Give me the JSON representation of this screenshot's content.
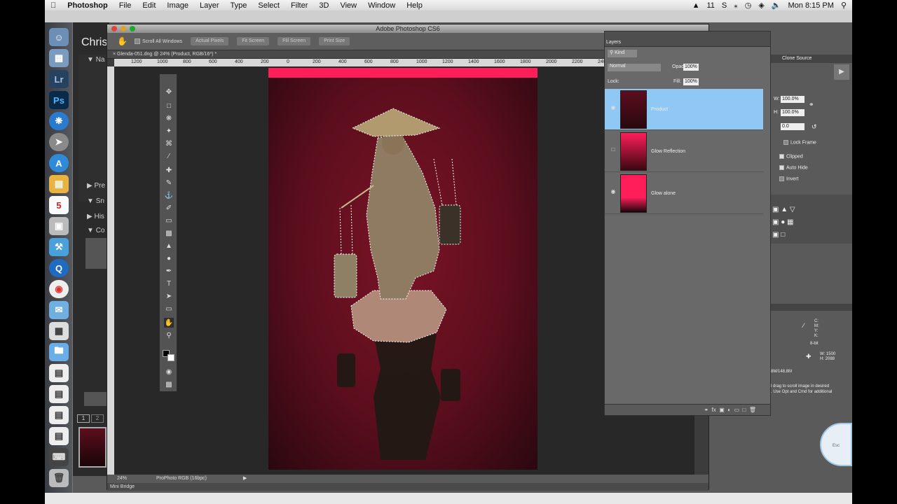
{
  "menubar": {
    "items": [
      "Photoshop",
      "File",
      "Edit",
      "Image",
      "Layer",
      "Type",
      "Select",
      "Filter",
      "3D",
      "View",
      "Window",
      "Help"
    ],
    "clock": "Mon 8:15 PM",
    "status_num": "11",
    "status_s": "S"
  },
  "lightroom": {
    "title": "Chris",
    "sections": [
      "Na",
      "Pre",
      "Sn",
      "His",
      "Co"
    ],
    "page_nums": [
      "1",
      "2"
    ]
  },
  "photoshop": {
    "window_title": "Adobe Photoshop CS6",
    "options": {
      "scroll_all_label": "Scroll All Windows",
      "buttons": [
        "Actual Pixels",
        "Fit Screen",
        "Fill Screen",
        "Print Size"
      ]
    },
    "doc_tab": "Glenda-051.dng @ 24% (Product, RGB/16*) *",
    "ruler": [
      "1200",
      "1000",
      "800",
      "600",
      "400",
      "200",
      "0",
      "200",
      "400",
      "600",
      "800",
      "1000",
      "1200",
      "1400",
      "1600",
      "1800",
      "2000",
      "2200",
      "2400",
      "2600",
      "2800"
    ],
    "status": {
      "zoom": "24%",
      "profile": "ProPhoto RGB (16bpc)"
    },
    "mini_bridge": "Mini Bridge"
  },
  "layers_panel": {
    "tab": "Layers",
    "kind": "Kind",
    "blend": "Normal",
    "opacity_label": "Opacity:",
    "opacity": "100%",
    "lock_label": "Lock:",
    "fill_label": "Fill:",
    "fill": "100%",
    "layers": [
      {
        "name": "Product",
        "visible": true,
        "selected": true
      },
      {
        "name": "Glow Reflection",
        "visible": false,
        "selected": false
      },
      {
        "name": "Glow alone",
        "visible": true,
        "selected": false
      }
    ],
    "footer_icons": [
      "link-icon",
      "fx-icon",
      "mask-icon",
      "adjustment-icon",
      "folder-icon",
      "new-layer-icon",
      "trash-icon"
    ]
  },
  "right_dock": {
    "clone_source_tab": "Clone Source",
    "w_label": "W:",
    "w": "100.0%",
    "h_label": "H:",
    "h": "100.0%",
    "angle": "0.0",
    "lock_frame": "Lock Frame",
    "clipped": "Clipped",
    "auto_hide": "Auto Hide",
    "invert": "Invert",
    "info_channels": [
      "C:",
      "M:",
      "Y:",
      "K:"
    ],
    "bit": "8-bit",
    "w_px": "1500",
    "h_px": "2088",
    "doc_size": "8M/148.8M",
    "hint": "l drag to scroll image in desired\n. Use Opt and Cmd for additional",
    "esc": "Esc"
  },
  "colors": {
    "accent_glow": "#ff1e5a",
    "selected_layer": "#8fc8f5"
  }
}
